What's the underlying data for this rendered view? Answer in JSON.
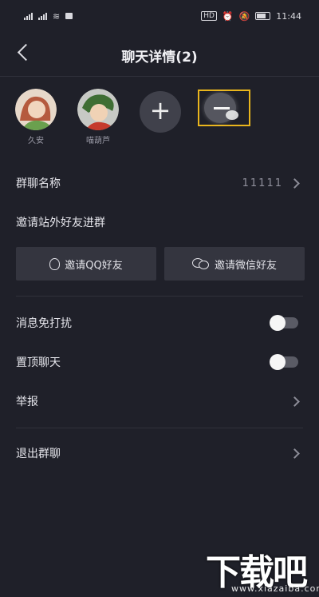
{
  "status_bar": {
    "left_symbols": "ᵢₗ ᵢₗ ≋",
    "hd_label": "HD",
    "time": "11:44"
  },
  "header": {
    "title": "聊天详情(2)"
  },
  "members": [
    {
      "name": "久安",
      "avatar_color": "#c98c6a"
    },
    {
      "name": "喵葫芦",
      "avatar_color": "#7db36e"
    }
  ],
  "member_actions": {
    "add_symbol": "+"
  },
  "group_name": {
    "label": "群聊名称",
    "value": "11111"
  },
  "invite": {
    "section_label": "邀请站外好友进群",
    "qq_button": "邀请QQ好友",
    "wechat_button": "邀请微信好友"
  },
  "settings": {
    "mute_label": "消息免打扰",
    "mute_on": false,
    "pin_label": "置顶聊天",
    "pin_on": false,
    "report_label": "举报"
  },
  "exit": {
    "label": "退出群聊"
  },
  "watermark": {
    "big": "下载吧",
    "small": "www.xiazaiba.com"
  },
  "colors": {
    "background": "#1f2029",
    "highlight": "#e9b51d",
    "button_bg": "#34353f"
  }
}
